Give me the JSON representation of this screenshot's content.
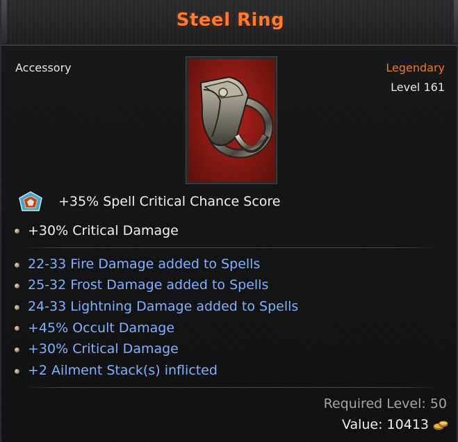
{
  "item": {
    "name": "Steel Ring",
    "type": "Accessory",
    "rarity": "Legendary",
    "level": "Level 161"
  },
  "implicit": {
    "icon": "socket-gem-icon",
    "text": "+35% Spell Critical Chance Score"
  },
  "base_stats": [
    "+30% Critical Damage"
  ],
  "affixes": [
    "22-33 Fire Damage added to Spells",
    "25-32 Frost Damage added to Spells",
    "24-33 Lightning Damage added to Spells",
    "+45% Occult Damage",
    "+30% Critical Damage",
    "+2 Ailment Stack(s) inflicted"
  ],
  "footer": {
    "required_level": "Required Level: 50",
    "value": "Value: 10413",
    "value_icon": "gold-coins-icon"
  },
  "colors": {
    "title": "#ff7a2c",
    "rarity": "#f07a22",
    "affix": "#7fb2ff",
    "icon_background": "#8c1a14"
  }
}
